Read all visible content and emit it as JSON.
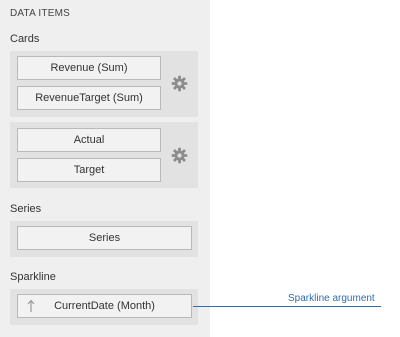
{
  "panel": {
    "title": "DATA ITEMS"
  },
  "sections": {
    "cards": {
      "label": "Cards",
      "groups": [
        {
          "fields": [
            "Revenue (Sum)",
            "RevenueTarget (Sum)"
          ],
          "options_icon": "gear-icon"
        },
        {
          "fields": [
            "Actual",
            "Target"
          ],
          "options_icon": "gear-icon"
        }
      ]
    },
    "series": {
      "label": "Series",
      "fields": [
        "Series"
      ]
    },
    "sparkline": {
      "label": "Sparkline",
      "fields": [
        {
          "label": "CurrentDate (Month)",
          "sort_icon": "sort-ascending-icon"
        }
      ]
    }
  },
  "callout": {
    "label": "Sparkline argument"
  },
  "colors": {
    "panel_background": "#efefef",
    "group_background": "#e2e2e2",
    "field_background": "#f2f2f2",
    "field_border": "#b9b9b9",
    "gear": "#8c8c8c",
    "callout": "#2e6eb5"
  }
}
